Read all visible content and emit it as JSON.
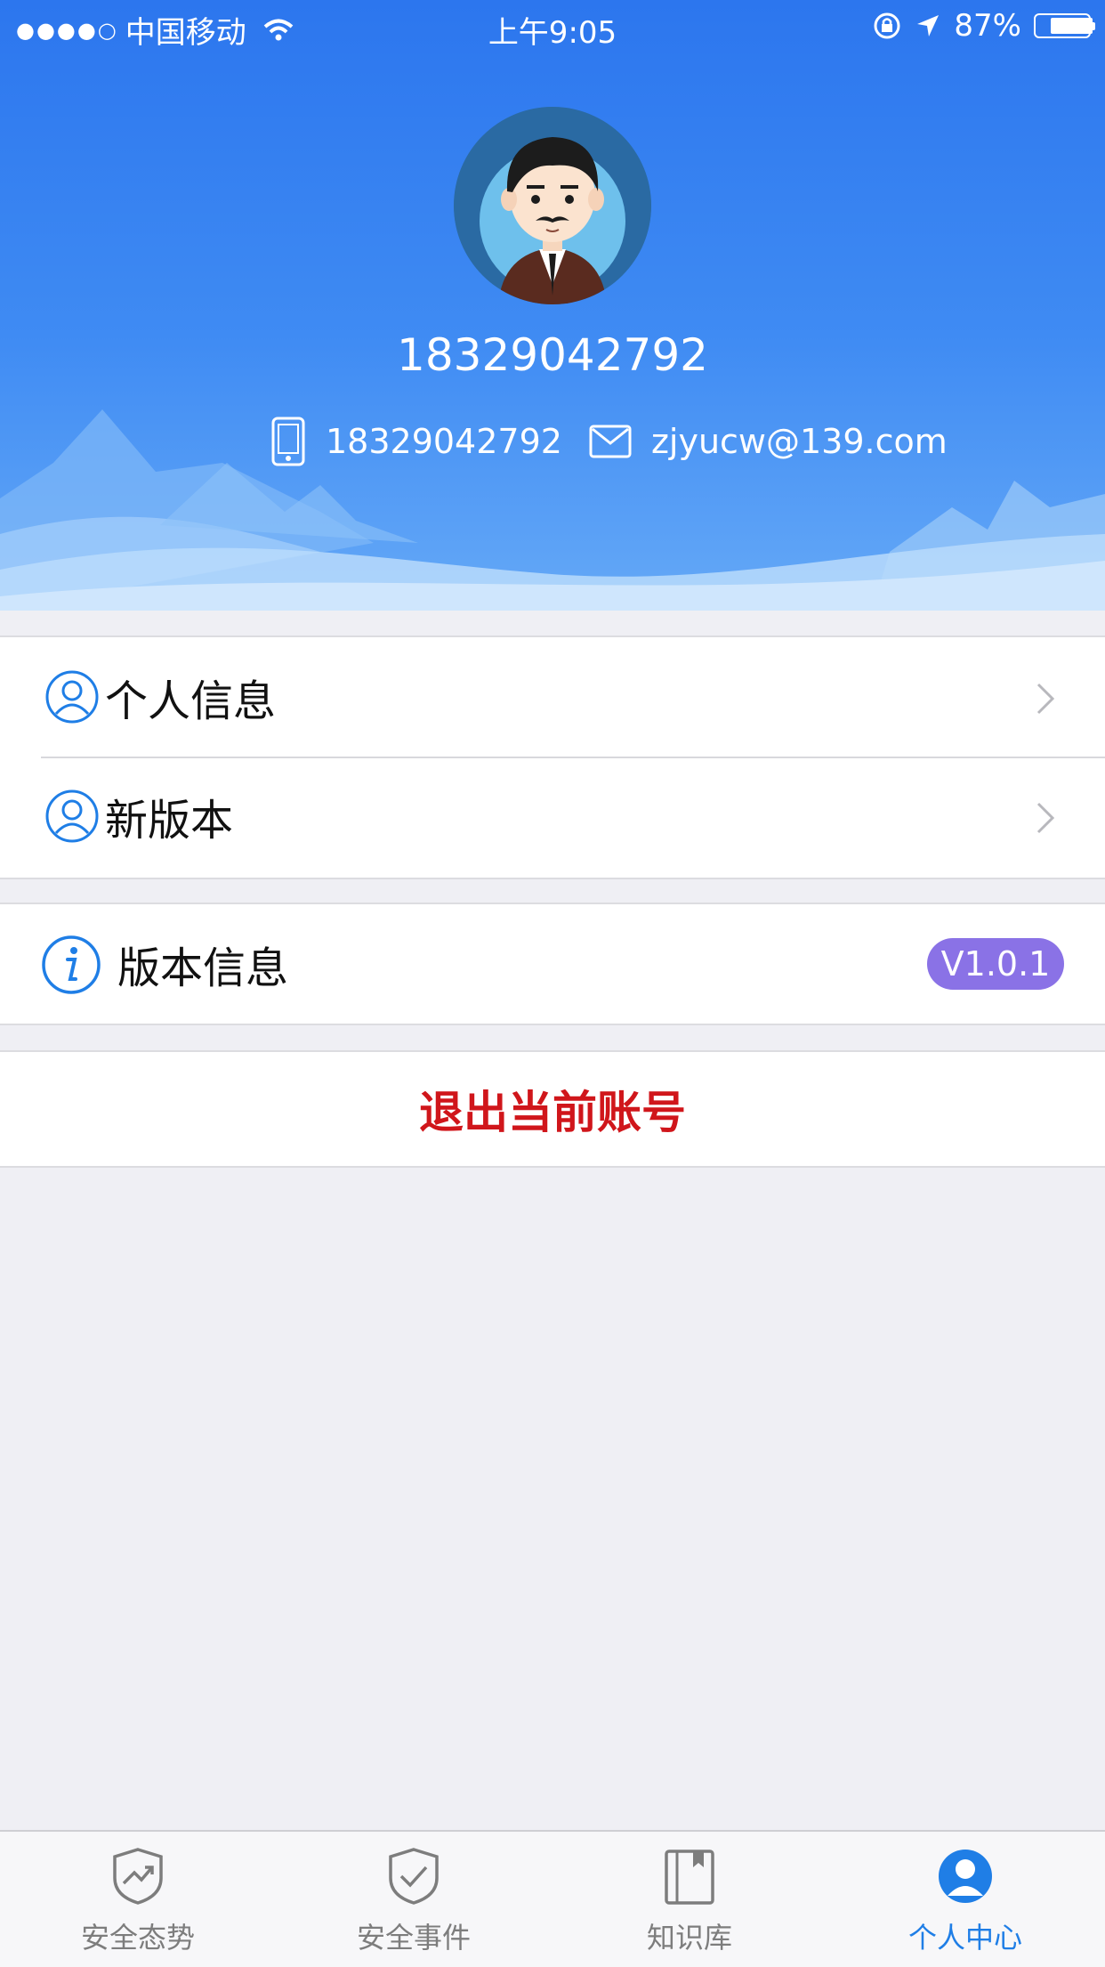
{
  "status_bar": {
    "signal": "●●●●○",
    "carrier": "中国移动",
    "time": "上午9:05",
    "battery": "87%",
    "battery_level": 0.87
  },
  "profile": {
    "username": "18329042792",
    "phone": "18329042792",
    "email": "zjyucw@139.com"
  },
  "menu": {
    "items": [
      {
        "label": "个人信息"
      },
      {
        "label": "新版本"
      }
    ],
    "version_label": "版本信息",
    "version_value": "V1.0.1",
    "logout_label": "退出当前账号"
  },
  "tabbar": {
    "tabs": [
      {
        "label": "安全态势",
        "icon": "shield-trend-icon"
      },
      {
        "label": "安全事件",
        "icon": "shield-check-icon"
      },
      {
        "label": "知识库",
        "icon": "book-icon"
      },
      {
        "label": "个人中心",
        "icon": "person-icon",
        "active": true
      }
    ]
  },
  "colors": {
    "header_blue": "#2c76ee",
    "accent": "#1f7ee6",
    "logout_red": "#d0161b",
    "badge_purple": "#8a72e6"
  }
}
